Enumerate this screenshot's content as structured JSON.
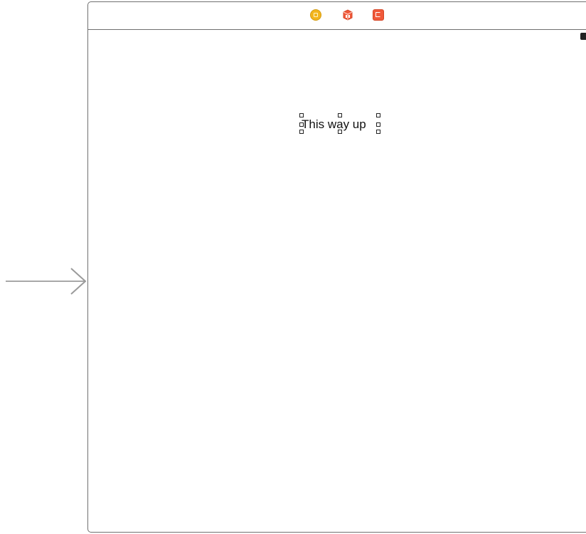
{
  "scene": {
    "dock": {
      "icons": [
        "view-controller-icon",
        "first-responder-icon",
        "exit-icon"
      ]
    },
    "status_bar": {
      "battery_icon": "battery-icon"
    },
    "label": {
      "text": "This way up",
      "selected": true
    }
  },
  "entry_point": {
    "icon": "entry-point-arrow-icon"
  },
  "colors": {
    "view_controller_icon": "#f3b51d",
    "first_responder_icon": "#f0593a",
    "exit_icon": "#f0593a",
    "scene_border": "#6f6f6f",
    "arrow": "#9a9a9a"
  }
}
